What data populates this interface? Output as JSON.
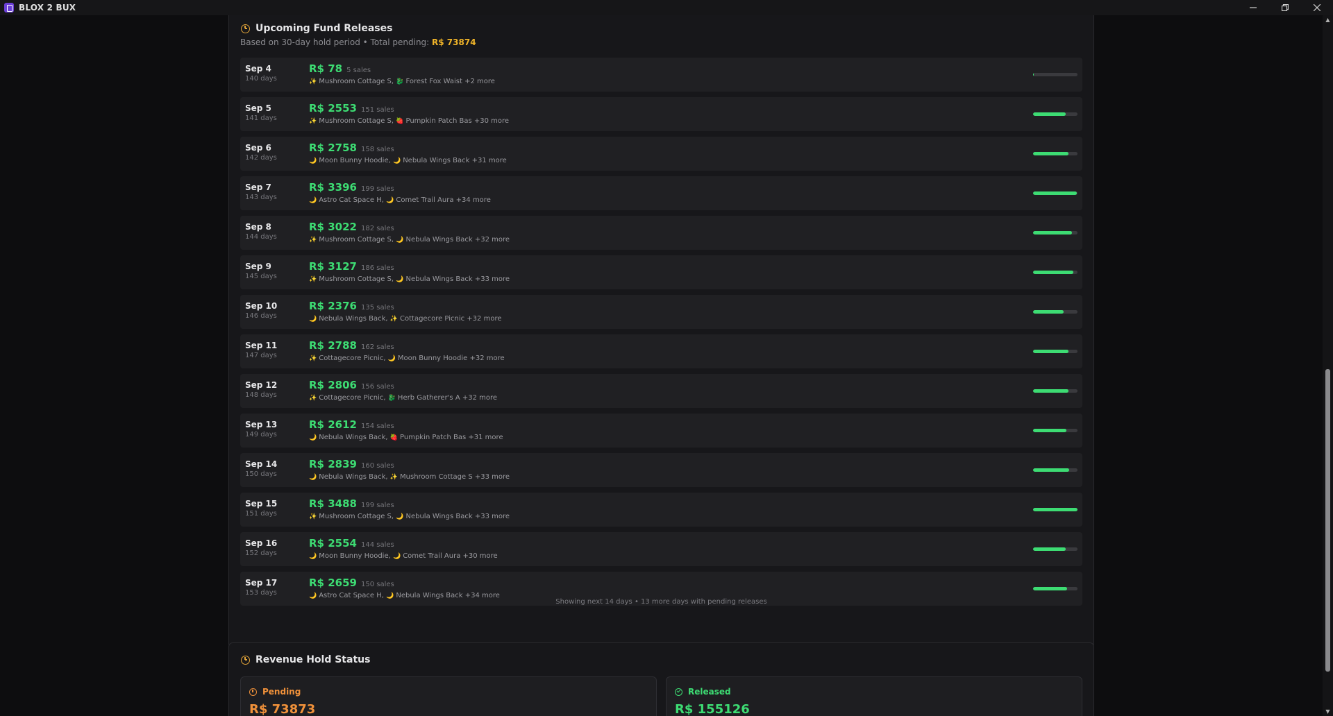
{
  "window": {
    "title": "BLOX 2 BUX"
  },
  "fund_releases": {
    "title": "Upcoming Fund Releases",
    "subtitle_prefix": "Based on 30-day hold period • Total pending: ",
    "total_pending": "R$ 73874",
    "footer": "Showing next 14 days • 13 more days with pending releases",
    "rows": [
      {
        "date": "Sep 4",
        "days": "140 days",
        "amount": "R$ 78",
        "sales": "5 sales",
        "item1_icon": "✨",
        "item1": "Mushroom Cottage S,",
        "item2_icon": "🐉",
        "item2": "Forest Fox Waist +2 more",
        "progress": 0.02
      },
      {
        "date": "Sep 5",
        "days": "141 days",
        "amount": "R$ 2553",
        "sales": "151 sales",
        "item1_icon": "✨",
        "item1": "Mushroom Cottage S,",
        "item2_icon": "🍓",
        "item2": "Pumpkin Patch Bas +30 more",
        "progress": 0.73
      },
      {
        "date": "Sep 6",
        "days": "142 days",
        "amount": "R$ 2758",
        "sales": "158 sales",
        "item1_icon": "🌙",
        "item1": "Moon Bunny Hoodie,",
        "item2_icon": "🌙",
        "item2": "Nebula Wings Back +31 more",
        "progress": 0.79
      },
      {
        "date": "Sep 7",
        "days": "143 days",
        "amount": "R$ 3396",
        "sales": "199 sales",
        "item1_icon": "🌙",
        "item1": "Astro Cat Space H,",
        "item2_icon": "🌙",
        "item2": "Comet Trail Aura +34 more",
        "progress": 0.98
      },
      {
        "date": "Sep 8",
        "days": "144 days",
        "amount": "R$ 3022",
        "sales": "182 sales",
        "item1_icon": "✨",
        "item1": "Mushroom Cottage S,",
        "item2_icon": "🌙",
        "item2": "Nebula Wings Back +32 more",
        "progress": 0.87
      },
      {
        "date": "Sep 9",
        "days": "145 days",
        "amount": "R$ 3127",
        "sales": "186 sales",
        "item1_icon": "✨",
        "item1": "Mushroom Cottage S,",
        "item2_icon": "🌙",
        "item2": "Nebula Wings Back +33 more",
        "progress": 0.9
      },
      {
        "date": "Sep 10",
        "days": "146 days",
        "amount": "R$ 2376",
        "sales": "135 sales",
        "item1_icon": "🌙",
        "item1": "Nebula Wings Back,",
        "item2_icon": "✨",
        "item2": "Cottagecore Picnic +32 more",
        "progress": 0.68
      },
      {
        "date": "Sep 11",
        "days": "147 days",
        "amount": "R$ 2788",
        "sales": "162 sales",
        "item1_icon": "✨",
        "item1": "Cottagecore Picnic,",
        "item2_icon": "🌙",
        "item2": "Moon Bunny Hoodie +32 more",
        "progress": 0.8
      },
      {
        "date": "Sep 12",
        "days": "148 days",
        "amount": "R$ 2806",
        "sales": "156 sales",
        "item1_icon": "✨",
        "item1": "Cottagecore Picnic,",
        "item2_icon": "🐉",
        "item2": "Herb Gatherer's A +32 more",
        "progress": 0.8
      },
      {
        "date": "Sep 13",
        "days": "149 days",
        "amount": "R$ 2612",
        "sales": "154 sales",
        "item1_icon": "🌙",
        "item1": "Nebula Wings Back,",
        "item2_icon": "🍓",
        "item2": "Pumpkin Patch Bas +31 more",
        "progress": 0.75
      },
      {
        "date": "Sep 14",
        "days": "150 days",
        "amount": "R$ 2839",
        "sales": "160 sales",
        "item1_icon": "🌙",
        "item1": "Nebula Wings Back,",
        "item2_icon": "✨",
        "item2": "Mushroom Cottage S +33 more",
        "progress": 0.81
      },
      {
        "date": "Sep 15",
        "days": "151 days",
        "amount": "R$ 3488",
        "sales": "199 sales",
        "item1_icon": "✨",
        "item1": "Mushroom Cottage S,",
        "item2_icon": "🌙",
        "item2": "Nebula Wings Back +33 more",
        "progress": 1.0
      },
      {
        "date": "Sep 16",
        "days": "152 days",
        "amount": "R$ 2554",
        "sales": "144 sales",
        "item1_icon": "🌙",
        "item1": "Moon Bunny Hoodie,",
        "item2_icon": "🌙",
        "item2": "Comet Trail Aura +30 more",
        "progress": 0.73
      },
      {
        "date": "Sep 17",
        "days": "153 days",
        "amount": "R$ 2659",
        "sales": "150 sales",
        "item1_icon": "🌙",
        "item1": "Astro Cat Space H,",
        "item2_icon": "🌙",
        "item2": "Nebula Wings Back +34 more",
        "progress": 0.76
      }
    ]
  },
  "hold_status": {
    "title": "Revenue Hold Status",
    "pending_label": "Pending",
    "pending_value": "R$ 73873",
    "released_label": "Released",
    "released_value": "R$ 155126"
  },
  "colors": {
    "accent_green": "#3ddc73",
    "pending_orange": "#f0913a",
    "total_yellow": "#f0b429"
  }
}
